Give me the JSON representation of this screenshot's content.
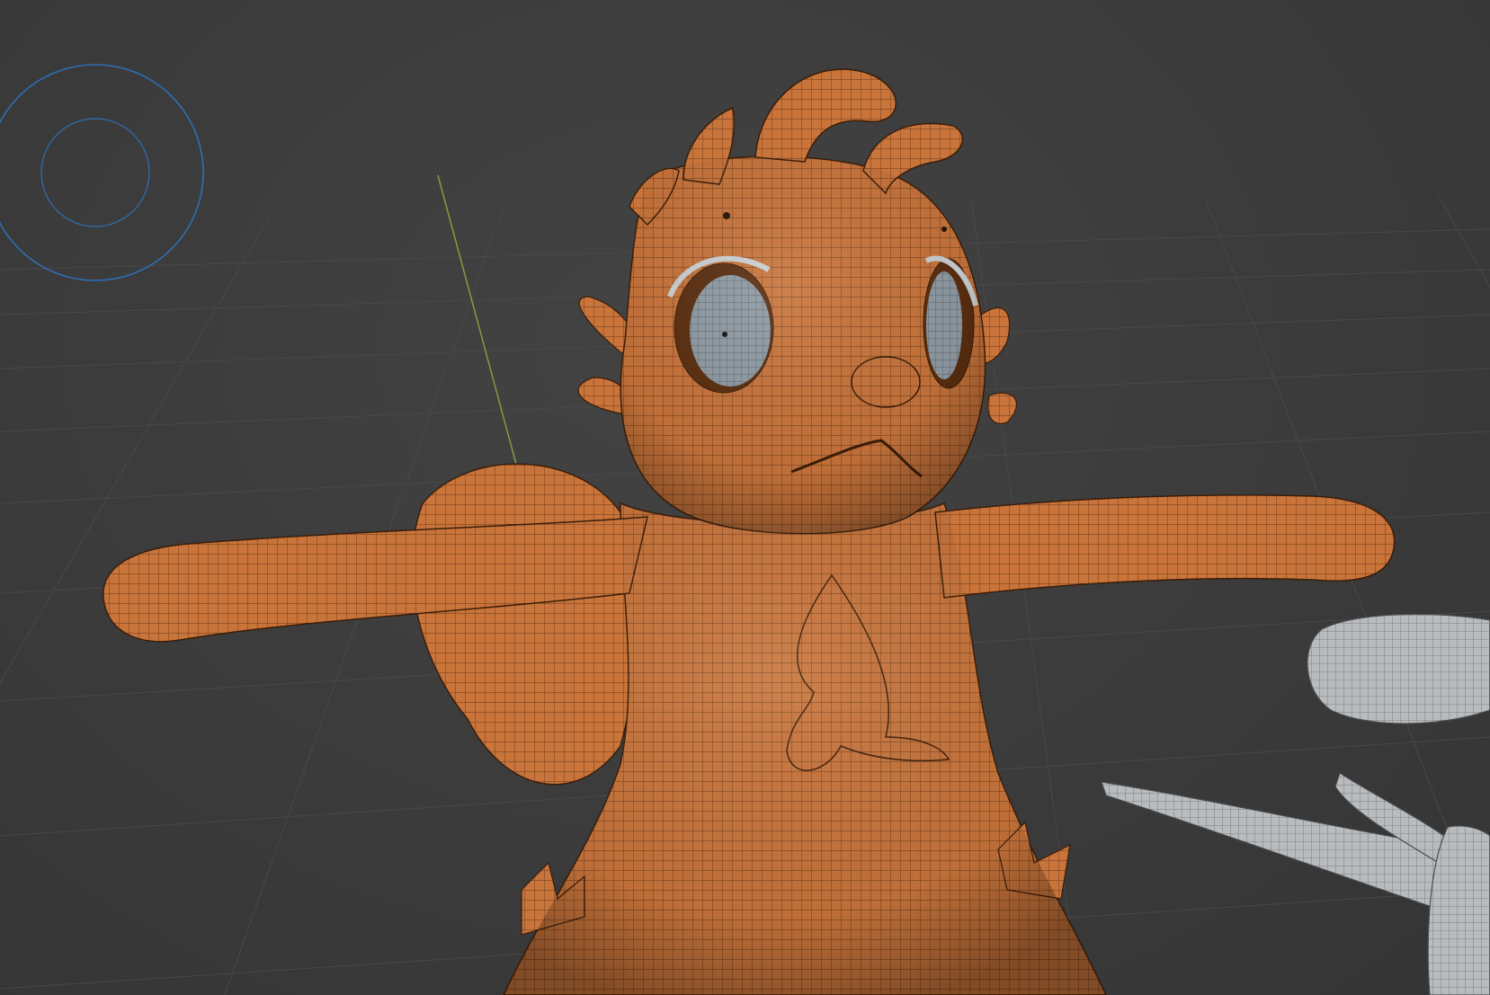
{
  "app": {
    "kind": "3d-viewport",
    "background_color": "#3a3a3a",
    "grid_color": "#4a4a4a",
    "y_axis_color": "#7f9f3c"
  },
  "viewport": {
    "navigation_gizmo_icon": "orbit-ring-icon",
    "gizmo_color": "#2f6fb2",
    "mesh_selected_color": "#c8743b",
    "mesh_selected_wire_color": "#5a2e10",
    "mesh_unselected_color": "#b9bcbf",
    "mesh_unselected_wire_color": "#6b6e71",
    "eye_color": "#8f9aa3",
    "overlay_mode": "wireframe"
  }
}
